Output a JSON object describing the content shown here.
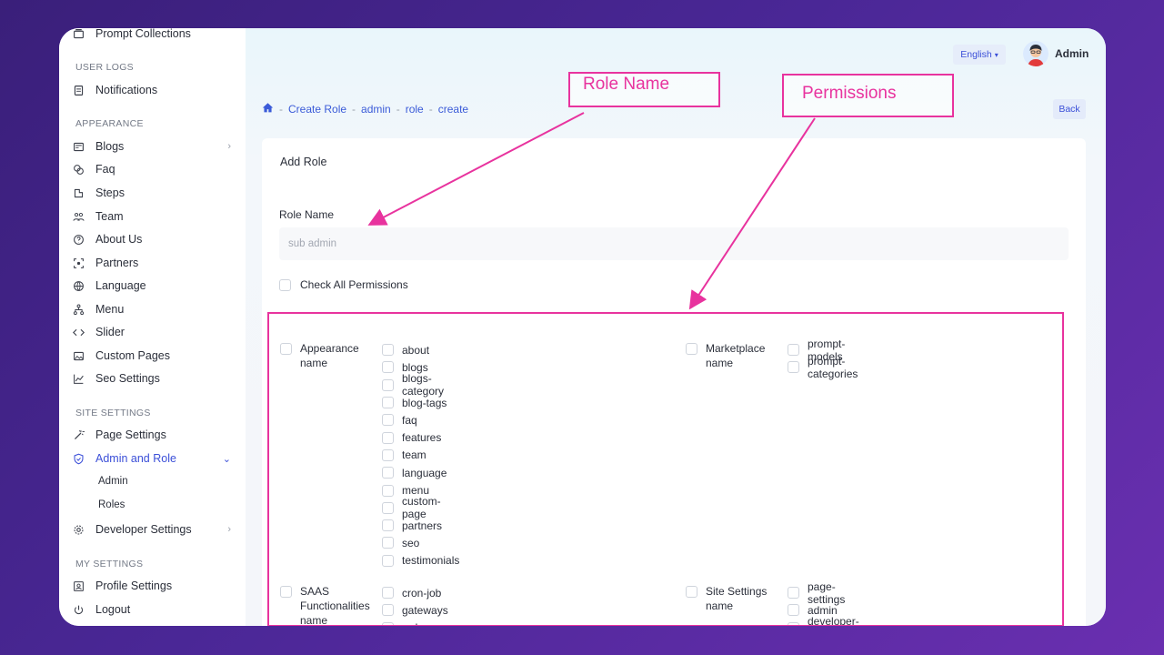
{
  "sidebar": {
    "top_item": "Prompt Collections",
    "sections": {
      "user_logs": "USER LOGS",
      "appearance": "APPEARANCE",
      "site_settings": "SITE SETTINGS",
      "my_settings": "MY SETTINGS"
    },
    "items": {
      "notifications": "Notifications",
      "blogs": "Blogs",
      "faq": "Faq",
      "steps": "Steps",
      "team": "Team",
      "about": "About Us",
      "partners": "Partners",
      "language": "Language",
      "menu": "Menu",
      "slider": "Slider",
      "custom_pages": "Custom Pages",
      "seo": "Seo Settings",
      "page_settings": "Page Settings",
      "admin_role": "Admin and Role",
      "admin": "Admin",
      "roles": "Roles",
      "developer": "Developer Settings",
      "profile": "Profile Settings",
      "logout": "Logout"
    }
  },
  "header": {
    "language": "English",
    "user_name": "Admin"
  },
  "breadcrumb": [
    "Create Role",
    "admin",
    "role",
    "create"
  ],
  "back_label": "Back",
  "form": {
    "title": "Add Role",
    "role_name_label": "Role Name",
    "role_name_placeholder": "sub admin",
    "check_all_label": "Check All Permissions"
  },
  "permission_groups": {
    "appearance": {
      "name": "Appearance name",
      "perms": [
        "about",
        "blogs",
        "blogs-category",
        "blog-tags",
        "faq",
        "features",
        "team",
        "language",
        "menu",
        "custom-page",
        "partners",
        "seo",
        "testimonials"
      ]
    },
    "marketplace": {
      "name": "Marketplace name",
      "perms": [
        "prompt-models",
        "prompt-categories"
      ]
    },
    "saas": {
      "name": "SAAS Functionalities name",
      "perms": [
        "cron-job",
        "gateways",
        "order"
      ]
    },
    "site": {
      "name": "Site Settings name",
      "perms": [
        "page-settings",
        "admin",
        "developer-settings"
      ]
    }
  },
  "annotations": {
    "role_name": "Role Name",
    "permissions": "Permissions",
    "color": "#e8339e"
  }
}
